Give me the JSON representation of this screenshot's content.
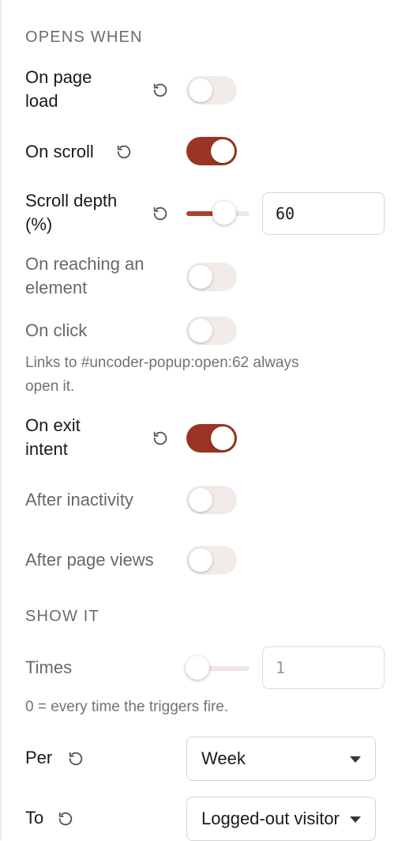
{
  "opens_when": {
    "title": "OPENS WHEN",
    "on_page_load": {
      "label_line1": "On page",
      "label_line2": "load",
      "enabled": false
    },
    "on_scroll": {
      "label": "On scroll",
      "enabled": true
    },
    "scroll_depth": {
      "label_line1": "Scroll depth",
      "label_line2": "(%)",
      "value": "60",
      "percent": 60
    },
    "on_reaching_element": {
      "label_line1": "On reaching an",
      "label_line2": "element",
      "enabled": false
    },
    "on_click": {
      "label": "On click",
      "enabled": false,
      "help_line1": "Links to #uncoder-popup:open:62 always",
      "help_line2": "open it."
    },
    "on_exit_intent": {
      "label_line1": "On exit",
      "label_line2": "intent",
      "enabled": true
    },
    "after_inactivity": {
      "label": "After inactivity",
      "enabled": false
    },
    "after_page_views": {
      "label": "After page views",
      "enabled": false
    }
  },
  "show_it": {
    "title": "SHOW IT",
    "times": {
      "label": "Times",
      "value": "1",
      "slider_level": 0.17,
      "help": "0 = every time the triggers fire."
    },
    "per": {
      "label": "Per",
      "selected": "Week"
    },
    "to": {
      "label": "To",
      "selected": "Logged-out visitors"
    }
  },
  "icons": {
    "reset": "reset-icon",
    "caret": "chevron-down-icon"
  },
  "colors": {
    "accent": "#9a3523",
    "toggle_off": "#f2ebe8",
    "muted_text": "#6c6764"
  }
}
